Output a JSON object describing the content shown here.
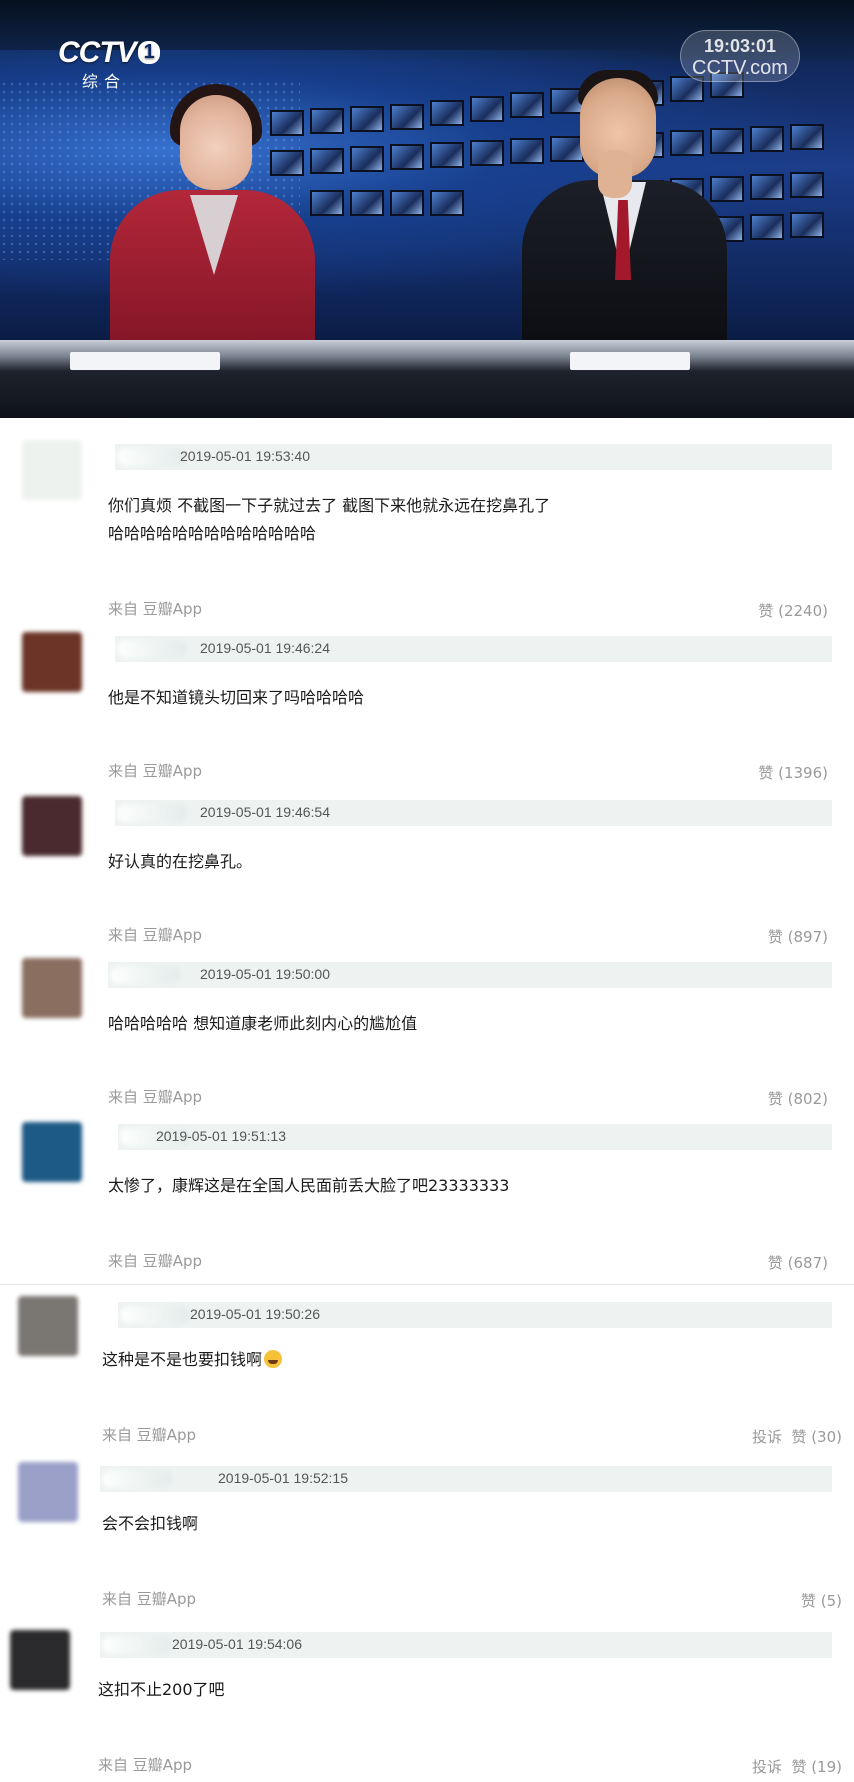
{
  "tv_still": {
    "channel_logo": "CCTV",
    "channel_number": "1",
    "channel_name": "综合",
    "watermark_clock": "19:03:01",
    "watermark_text": "CCTV.com"
  },
  "comments": [
    {
      "timestamp": "2019-05-01 19:53:40",
      "text_line1": "你们真烦 不截图一下子就过去了 截图下来他就永远在挖鼻孔了",
      "text_line2": "哈哈哈哈哈哈哈哈哈哈哈哈哈",
      "source": "来自 豆瓣App",
      "likes": "赞 (2240)",
      "report": "",
      "avatar_color": "#eef2ee"
    },
    {
      "timestamp": "2019-05-01 19:46:24",
      "text_line1": "他是不知道镜头切回来了吗哈哈哈哈",
      "text_line2": "",
      "source": "来自 豆瓣App",
      "likes": "赞 (1396)",
      "report": "",
      "avatar_color": "#6b3426"
    },
    {
      "timestamp": "2019-05-01 19:46:54",
      "text_line1": "好认真的在挖鼻孔。",
      "text_line2": "",
      "source": "来自 豆瓣App",
      "likes": "赞 (897)",
      "report": "",
      "avatar_color": "#4a2a2e"
    },
    {
      "timestamp": "2019-05-01 19:50:00",
      "text_line1": "哈哈哈哈哈 想知道康老师此刻内心的尴尬值",
      "text_line2": "",
      "source": "来自 豆瓣App",
      "likes": "赞 (802)",
      "report": "",
      "avatar_color": "#8a6e60"
    },
    {
      "timestamp": "2019-05-01 19:51:13",
      "text_line1": "太惨了，康辉这是在全国人民面前丢大脸了吧23333333",
      "text_line2": "",
      "source": "来自 豆瓣App",
      "likes": "赞 (687)",
      "report": "",
      "avatar_color": "#1d5a86"
    },
    {
      "timestamp": "2019-05-01 19:50:26",
      "text_line1": "这种是不是也要扣钱啊",
      "text_line2": "",
      "source": "来自 豆瓣App",
      "likes": "赞 (30)",
      "report": "投诉",
      "avatar_color": "#7a7672"
    },
    {
      "timestamp": "2019-05-01 19:52:15",
      "text_line1": "会不会扣钱啊",
      "text_line2": "",
      "source": "来自 豆瓣App",
      "likes": "赞 (5)",
      "report": "",
      "avatar_color": "#9aa0c8"
    },
    {
      "timestamp": "2019-05-01 19:54:06",
      "text_line1": "这扣不止200了吧",
      "text_line2": "",
      "source": "来自 豆瓣App",
      "likes": "赞 (19)",
      "report": "投诉",
      "avatar_color": "#2b2b2d"
    }
  ]
}
